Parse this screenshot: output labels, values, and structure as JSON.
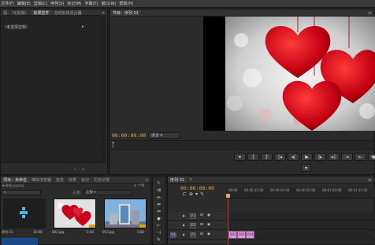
{
  "menu": [
    "文件(F)",
    "编辑(E)",
    "剪辑(C)",
    "序列(S)",
    "标记(M)",
    "字幕(T)",
    "窗口(W)",
    "帮助(H)"
  ],
  "left_panel": {
    "tabs": [
      "源：（无剪辑）",
      "效果控件",
      "音频剪辑混合器"
    ],
    "active_tab": 1,
    "header": "（未选择剪辑）"
  },
  "program": {
    "tab": "节目：序列 01",
    "timecode": "00:00:00:00",
    "fit": "适合"
  },
  "project": {
    "tabs": [
      "项目：未命名",
      "媒体浏览器",
      "信息",
      "效果",
      "标记",
      "历史记录"
    ],
    "path": "未命名.prproj",
    "items_count": "4 个项",
    "entry_label": "入点：",
    "entry_value": "全部",
    "items": [
      {
        "name": "序列 01",
        "duration": "15:00"
      },
      {
        "name": "002.jpg",
        "duration": "5:00"
      },
      {
        "name": "003.jpg",
        "duration": "5:00"
      }
    ]
  },
  "timeline": {
    "tab": "序列 01",
    "timecode": "00:00:00:00",
    "ticks": [
      "00:00",
      "00:00:15:00",
      "00:00:30:00",
      "00:00:45:00",
      "00:01:00:00",
      "00:01:15:00"
    ],
    "tracks": [
      {
        "name": "V3",
        "toggle": "V3"
      },
      {
        "name": "V2",
        "toggle": "V2"
      },
      {
        "name": "V1",
        "toggle": "V1",
        "source": "V1"
      }
    ],
    "clips": [
      "002",
      "003",
      "004"
    ]
  },
  "colors": {
    "timecode": "#e5a74d",
    "clip": "#d99bd9",
    "playhead": "#d23a3a"
  }
}
